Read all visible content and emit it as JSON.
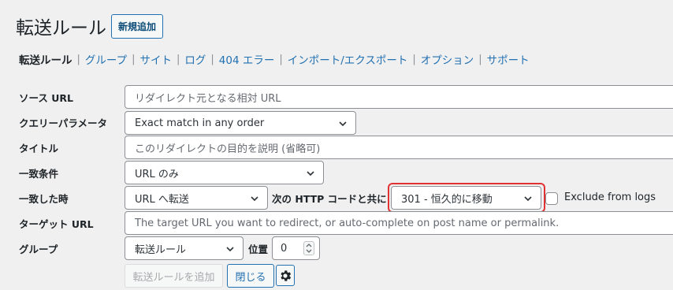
{
  "header": {
    "title": "転送ルール",
    "add_new_label": "新規追加"
  },
  "subnav": {
    "items": [
      "転送ルール",
      "グループ",
      "サイト",
      "ログ",
      "404 エラー",
      "インポート/エクスポート",
      "オプション",
      "サポート"
    ],
    "separator": "|"
  },
  "form": {
    "source_url": {
      "label": "ソース URL",
      "placeholder": "リダイレクト元となる相対 URL"
    },
    "query_params": {
      "label": "クエリーパラメータ",
      "value": "Exact match in any order"
    },
    "title": {
      "label": "タイトル",
      "placeholder": "このリダイレクトの目的を説明 (省略可)"
    },
    "match": {
      "label": "一致条件",
      "value": "URL のみ"
    },
    "when_matched": {
      "label": "一致した時",
      "action_value": "URL へ転送",
      "http_code_label": "次の HTTP コードと共に",
      "http_code_value": "301 - 恒久的に移動",
      "exclude_logs_label": "Exclude from logs",
      "exclude_logs_checked": false
    },
    "target_url": {
      "label": "ターゲット URL",
      "placeholder": "The target URL you want to redirect, or auto-complete on post name or permalink."
    },
    "group": {
      "label": "グループ",
      "value": "転送ルール",
      "position_label": "位置",
      "position_value": "0"
    }
  },
  "actions": {
    "add_label": "転送ルールを追加",
    "close_label": "閉じる"
  },
  "colors": {
    "accent": "#2271b1",
    "highlight": "#e03232",
    "background": "#f0f0f1"
  }
}
